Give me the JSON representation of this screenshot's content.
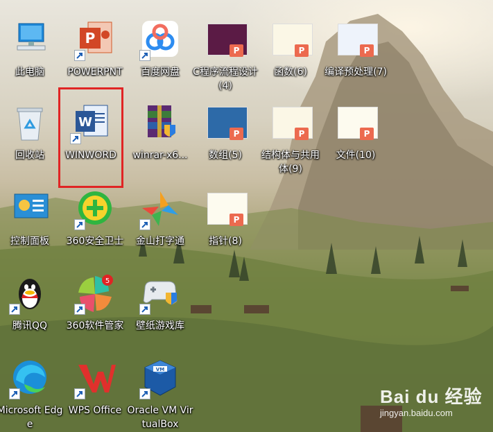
{
  "desktop": {
    "icons": [
      {
        "label": "此电脑",
        "icon": "computer-icon"
      },
      {
        "label": "POWERPNT",
        "icon": "powerpoint-icon"
      },
      {
        "label": "百度网盘",
        "icon": "baidu-netdisk-icon"
      },
      {
        "label": "C程序流程设计(4)",
        "icon": "pptx-file-icon"
      },
      {
        "label": "函数(6)",
        "icon": "pptx-file-icon"
      },
      {
        "label": "编译预处理(7)",
        "icon": "pptx-file-icon"
      },
      {
        "label": "回收站",
        "icon": "recycle-bin-icon"
      },
      {
        "label": "WINWORD",
        "icon": "word-icon"
      },
      {
        "label": "winrar-x6...",
        "icon": "winrar-installer-icon"
      },
      {
        "label": "数组(5)",
        "icon": "pptx-file-icon"
      },
      {
        "label": "结构体与共用体(9)",
        "icon": "pptx-file-icon"
      },
      {
        "label": "文件(10)",
        "icon": "pptx-file-icon"
      },
      {
        "label": "控制面板",
        "icon": "control-panel-icon"
      },
      {
        "label": "360安全卫士",
        "icon": "360-safe-icon"
      },
      {
        "label": "金山打字通",
        "icon": "kingsoft-typing-icon"
      },
      {
        "label": "指针(8)",
        "icon": "pptx-file-icon"
      },
      {
        "label": "腾讯QQ",
        "icon": "qq-icon"
      },
      {
        "label": "360软件管家",
        "icon": "360-software-manager-icon"
      },
      {
        "label": "壁纸游戏库",
        "icon": "wallpaper-game-library-icon"
      },
      {
        "label": "Microsoft Edge",
        "icon": "edge-icon"
      },
      {
        "label": "WPS Office",
        "icon": "wps-office-icon"
      },
      {
        "label": "Oracle VM VirtualBox",
        "icon": "virtualbox-icon"
      }
    ],
    "badges": {
      "software_manager_count": "5"
    },
    "ppt_badge_letter": "P",
    "selected_icon": "WINWORD",
    "colors": {
      "highlight": "#e02424",
      "ppt_badge": "#ec6a4f"
    }
  },
  "watermark": {
    "brand": "Bai du 经验",
    "url": "jingyan.baidu.com"
  }
}
